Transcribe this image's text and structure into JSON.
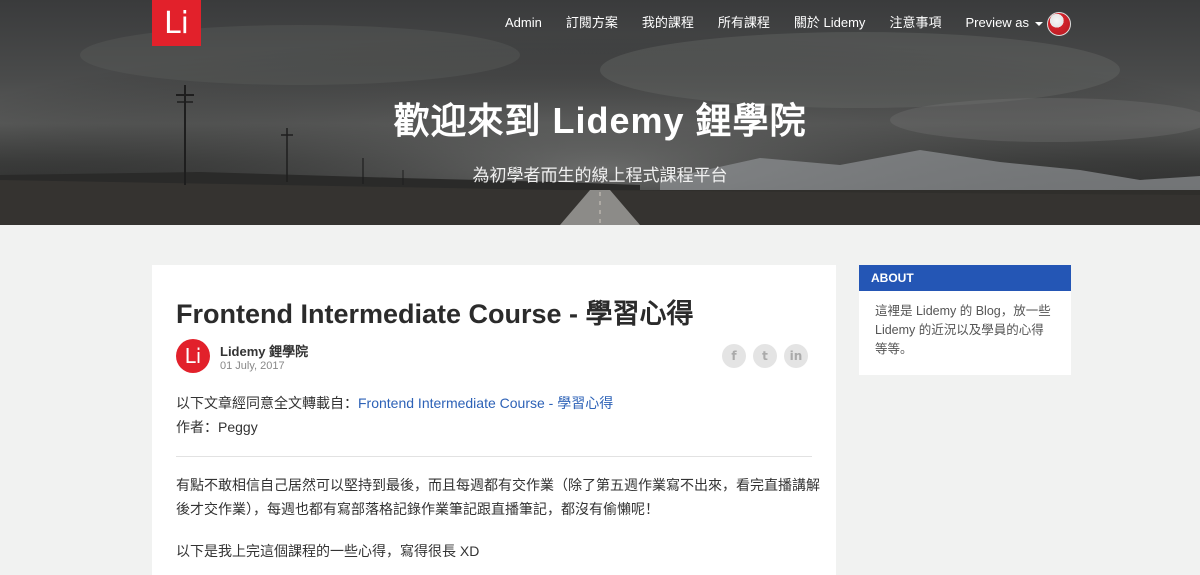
{
  "brand": {
    "logo_text": "Li",
    "logo_color": "#e2212b"
  },
  "nav": {
    "items": [
      "Admin",
      "訂閱方案",
      "我的課程",
      "所有課程",
      "關於 Lidemy",
      "注意事項"
    ],
    "preview_label": "Preview as"
  },
  "hero": {
    "title": "歡迎來到 Lidemy 鋰學院",
    "subtitle": "為初學者而生的線上程式課程平台"
  },
  "post": {
    "title": "Frontend Intermediate Course - 學習心得",
    "author": "Lidemy 鋰學院",
    "author_avatar_text": "Li",
    "date": "01 July, 2017",
    "share_icons": [
      "facebook-icon",
      "twitter-icon",
      "linkedin-icon"
    ],
    "share_glyphs": [
      "f",
      "t",
      "in"
    ],
    "repost_prefix": "以下文章經同意全文轉載自：",
    "repost_link": "Frontend Intermediate Course - 學習心得",
    "author_line": "作者：Peggy",
    "para1_line1": "有點不敢相信自己居然可以堅持到最後，而且每週都有交作業（除了第五週作業寫不出來，看完直播講解",
    "para1_line2": "後才交作業），每週也都有寫部落格記錄作業筆記跟直播筆記，都沒有偷懶呢！",
    "para2": "以下是我上完這個課程的一些心得，寫得很長 XD"
  },
  "sidebar": {
    "about_heading": "ABOUT",
    "about_line1": "這裡是 Lidemy 的 Blog，放一些",
    "about_line2": "Lidemy 的近況以及學員的心得",
    "about_line3": "等等。",
    "accent_color": "#2456b5"
  }
}
